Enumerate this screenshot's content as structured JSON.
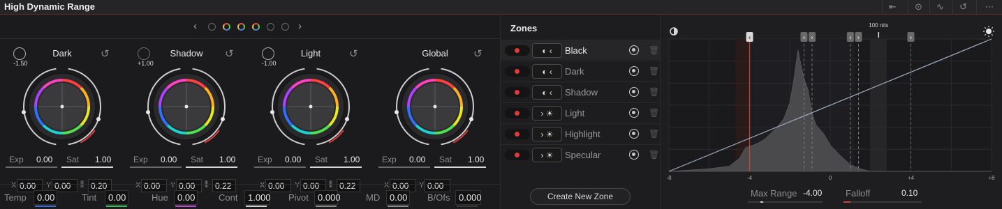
{
  "titlebar": {
    "title": "High Dynamic Range"
  },
  "wheels": [
    {
      "name": "Dark",
      "adj": "-1.50",
      "exp_label": "Exp",
      "exp": "0.00",
      "sat_label": "Sat",
      "sat": "1.00",
      "x_label": "X",
      "x": "0.00",
      "y_label": "Y",
      "y": "0.00",
      "z": "0.20"
    },
    {
      "name": "Shadow",
      "adj": "+1.00",
      "exp_label": "Exp",
      "exp": "0.00",
      "sat_label": "Sat",
      "sat": "1.00",
      "x_label": "X",
      "x": "0.00",
      "y_label": "Y",
      "y": "0.00",
      "z": "0.22"
    },
    {
      "name": "Light",
      "adj": "-1.00",
      "exp_label": "Exp",
      "exp": "0.00",
      "sat_label": "Sat",
      "sat": "1.00",
      "x_label": "X",
      "x": "0.00",
      "y_label": "Y",
      "y": "0.00",
      "z": "0.22"
    },
    {
      "name": "Global",
      "adj": "",
      "exp_label": "Exp",
      "exp": "0.00",
      "sat_label": "Sat",
      "sat": "1.00",
      "x_label": "X",
      "x": "0.00",
      "y_label": "Y",
      "y": "0.00",
      "z": ""
    }
  ],
  "params": [
    {
      "label": "Temp",
      "value": "0.00",
      "bar": "#3a6ad8"
    },
    {
      "label": "Tint",
      "value": "0.00",
      "bar": "#3ac05a"
    },
    {
      "label": "Hue",
      "value": "0.00",
      "bar": "#c04ad8"
    },
    {
      "label": "Cont",
      "value": "1.000",
      "bar": "#cfcfcf"
    },
    {
      "label": "Pivot",
      "value": "0.000",
      "bar": "#8a8a8a"
    },
    {
      "label": "MD",
      "value": "0.00",
      "bar": "#8a8a8a"
    },
    {
      "label": "B/Ofs",
      "value": "0.000",
      "bar": "#3a3a3a"
    }
  ],
  "zones": {
    "title": "Zones",
    "items": [
      {
        "name": "Black",
        "icon": "dark"
      },
      {
        "name": "Dark",
        "icon": "dark"
      },
      {
        "name": "Shadow",
        "icon": "dark"
      },
      {
        "name": "Light",
        "icon": "light"
      },
      {
        "name": "Highlight",
        "icon": "light"
      },
      {
        "name": "Specular",
        "icon": "light"
      }
    ],
    "create_label": "Create New Zone"
  },
  "graph": {
    "nits_label": "100 nits",
    "x_ticks": [
      "-8",
      "-4",
      "0",
      "+4",
      "+8"
    ],
    "max_range_label": "Max Range",
    "max_range": "-4.00",
    "falloff_label": "Falloff",
    "falloff": "0.10"
  },
  "colors": {
    "accent_red": "#e23a3a",
    "title_border": "#6b2525"
  }
}
